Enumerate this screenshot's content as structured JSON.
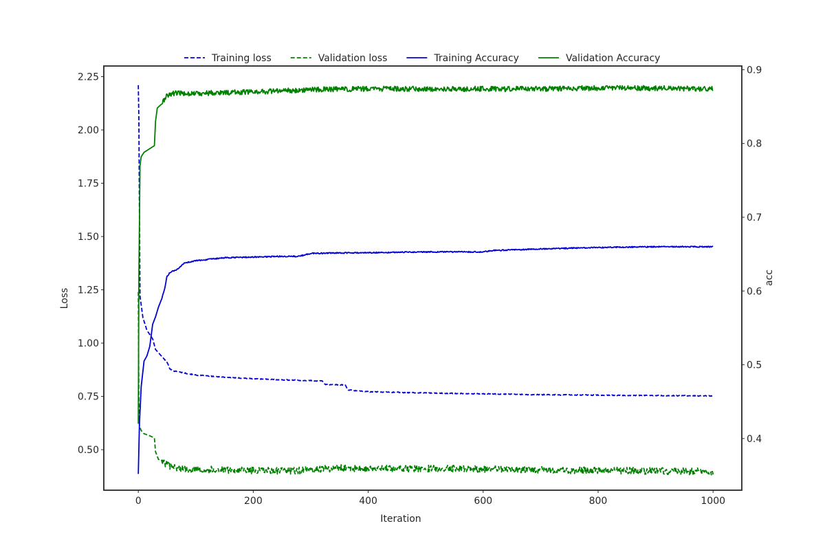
{
  "chart_data": {
    "type": "line",
    "title": "",
    "xlabel": "Iteration",
    "ylabel_left": "Loss",
    "ylabel_right": "acc",
    "xlim": [
      -60,
      1050
    ],
    "ylim_left": [
      0.31,
      2.3
    ],
    "ylim_right": [
      0.33,
      0.905
    ],
    "xticks": [
      0,
      200,
      400,
      600,
      800,
      1000
    ],
    "yticks_left": [
      0.5,
      0.75,
      1.0,
      1.25,
      1.5,
      1.75,
      2.0,
      2.25
    ],
    "yticks_left_labels": [
      "0.50",
      "0.75",
      "1.00",
      "1.25",
      "1.50",
      "1.75",
      "2.00",
      "2.25"
    ],
    "yticks_right": [
      0.4,
      0.5,
      0.6,
      0.7,
      0.8,
      0.9
    ],
    "yticks_right_labels": [
      "0.4",
      "0.5",
      "0.6",
      "0.7",
      "0.8",
      "0.9"
    ],
    "grid": false,
    "legend_position": "top-center",
    "series": [
      {
        "name": "Training loss",
        "axis": "left",
        "style": "dashed",
        "color": "#0000d6",
        "noise": 0.002,
        "points": [
          [
            0,
            2.21
          ],
          [
            1,
            2.05
          ],
          [
            2,
            1.6
          ],
          [
            3,
            1.22
          ],
          [
            5,
            1.18
          ],
          [
            8,
            1.12
          ],
          [
            15,
            1.06
          ],
          [
            25,
            1.02
          ],
          [
            30,
            0.97
          ],
          [
            40,
            0.94
          ],
          [
            50,
            0.91
          ],
          [
            55,
            0.88
          ],
          [
            60,
            0.87
          ],
          [
            80,
            0.86
          ],
          [
            100,
            0.85
          ],
          [
            150,
            0.84
          ],
          [
            200,
            0.833
          ],
          [
            250,
            0.828
          ],
          [
            300,
            0.824
          ],
          [
            320,
            0.822
          ],
          [
            325,
            0.806
          ],
          [
            360,
            0.804
          ],
          [
            365,
            0.78
          ],
          [
            400,
            0.772
          ],
          [
            450,
            0.769
          ],
          [
            500,
            0.766
          ],
          [
            550,
            0.764
          ],
          [
            600,
            0.762
          ],
          [
            700,
            0.758
          ],
          [
            800,
            0.756
          ],
          [
            900,
            0.754
          ],
          [
            1000,
            0.752
          ]
        ]
      },
      {
        "name": "Validation loss",
        "axis": "left",
        "style": "dashed",
        "color": "#008000",
        "noise": 0.016,
        "points": [
          [
            0,
            1.24
          ],
          [
            1,
            0.72
          ],
          [
            2,
            0.61
          ],
          [
            5,
            0.59
          ],
          [
            10,
            0.575
          ],
          [
            20,
            0.565
          ],
          [
            28,
            0.555
          ],
          [
            30,
            0.49
          ],
          [
            35,
            0.455
          ],
          [
            45,
            0.44
          ],
          [
            55,
            0.42
          ],
          [
            80,
            0.41
          ],
          [
            150,
            0.405
          ],
          [
            250,
            0.4
          ],
          [
            300,
            0.405
          ],
          [
            350,
            0.415
          ],
          [
            400,
            0.41
          ],
          [
            500,
            0.412
          ],
          [
            600,
            0.41
          ],
          [
            700,
            0.405
          ],
          [
            800,
            0.402
          ],
          [
            900,
            0.4
          ],
          [
            1000,
            0.398
          ]
        ]
      },
      {
        "name": "Training Accuracy",
        "axis": "right",
        "style": "solid",
        "color": "#0000d6",
        "noise": 0.0008,
        "points": [
          [
            0,
            0.352
          ],
          [
            2,
            0.42
          ],
          [
            5,
            0.47
          ],
          [
            10,
            0.505
          ],
          [
            15,
            0.512
          ],
          [
            20,
            0.525
          ],
          [
            25,
            0.555
          ],
          [
            30,
            0.565
          ],
          [
            35,
            0.578
          ],
          [
            40,
            0.588
          ],
          [
            45,
            0.6
          ],
          [
            50,
            0.62
          ],
          [
            55,
            0.625
          ],
          [
            70,
            0.63
          ],
          [
            80,
            0.638
          ],
          [
            100,
            0.641
          ],
          [
            150,
            0.645
          ],
          [
            200,
            0.646
          ],
          [
            250,
            0.647
          ],
          [
            280,
            0.647
          ],
          [
            300,
            0.651
          ],
          [
            400,
            0.652
          ],
          [
            500,
            0.653
          ],
          [
            600,
            0.653
          ],
          [
            620,
            0.655
          ],
          [
            700,
            0.657
          ],
          [
            800,
            0.659
          ],
          [
            900,
            0.66
          ],
          [
            1000,
            0.66
          ]
        ]
      },
      {
        "name": "Validation Accuracy",
        "axis": "right",
        "style": "solid",
        "color": "#008000",
        "noise": 0.0035,
        "points": [
          [
            0,
            0.42
          ],
          [
            1,
            0.62
          ],
          [
            3,
            0.77
          ],
          [
            5,
            0.782
          ],
          [
            10,
            0.788
          ],
          [
            20,
            0.793
          ],
          [
            28,
            0.797
          ],
          [
            30,
            0.83
          ],
          [
            33,
            0.848
          ],
          [
            40,
            0.853
          ],
          [
            50,
            0.865
          ],
          [
            60,
            0.868
          ],
          [
            100,
            0.868
          ],
          [
            200,
            0.87
          ],
          [
            300,
            0.873
          ],
          [
            400,
            0.874
          ],
          [
            500,
            0.874
          ],
          [
            600,
            0.874
          ],
          [
            700,
            0.874
          ],
          [
            800,
            0.875
          ],
          [
            900,
            0.875
          ],
          [
            1000,
            0.874
          ]
        ]
      }
    ]
  }
}
